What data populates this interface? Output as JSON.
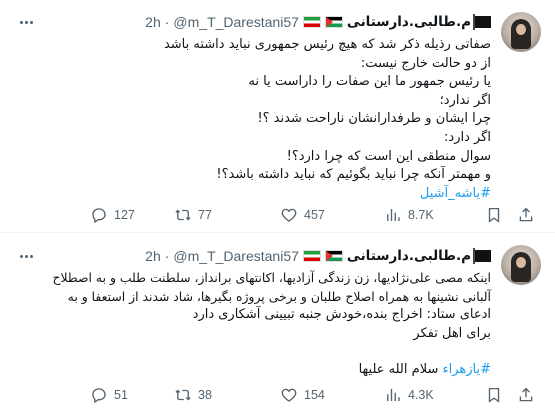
{
  "tweets": [
    {
      "author": {
        "name": "م.طالبی.دارستانی",
        "handle": "@m_T_Darestani57",
        "dot": "·",
        "time": "2h"
      },
      "lines": [
        "صفاتی رذیله ذکر شد که هیچ رئیس جمهوری نباید داشته باشد",
        "از دو حالت خارج نیست:",
        "یا رئیس جمهور ما این صفات را داراست یا نه",
        "اگر ندارد؛",
        "چرا ایشان و طرفدارانشان ناراحت شدند ؟!",
        "اگر دارد:",
        "سوال منطقی این است که چرا دارد؟!",
        "و مهمتر آنکه چرا نباید بگوئیم که نباید داشته باشد؟!"
      ],
      "hashtag": "#یاشه_آشیل",
      "stats": {
        "replies": "127",
        "reposts": "77",
        "likes": "457",
        "views": "8.7K"
      }
    },
    {
      "author": {
        "name": "م.طالبی.دارستانی",
        "handle": "@m_T_Darestani57",
        "dot": "·",
        "time": "2h"
      },
      "lines": [
        "اینکه مصی علی‌نژادیها، زن زندگی آزادیها، اکانتهای برانداز، سلطنت طلب و به اصطلاح",
        "آلبانی نشینها به همراه اصلاح طلبان و برخی پروژه بگیرها، شاد شدند از استعفا و به",
        "ادعای ستاد: اخراج بنده،خودش جنبه تبیینی آشکاری دارد",
        "برای اهل تفکر"
      ],
      "hashtag": "#یازهراء",
      "hashtag_suffix": " سلام الله علیها",
      "stats": {
        "replies": "51",
        "reposts": "38",
        "likes": "154",
        "views": "4.3K"
      }
    }
  ],
  "icons": [
    "reply-icon",
    "repost-icon",
    "like-icon",
    "views-icon",
    "bookmark-icon",
    "share-icon",
    "more-icon"
  ],
  "colors": {
    "accent": "#1d9bf0",
    "text": "#0f1419",
    "muted": "#536471",
    "divider": "#eff3f4"
  }
}
